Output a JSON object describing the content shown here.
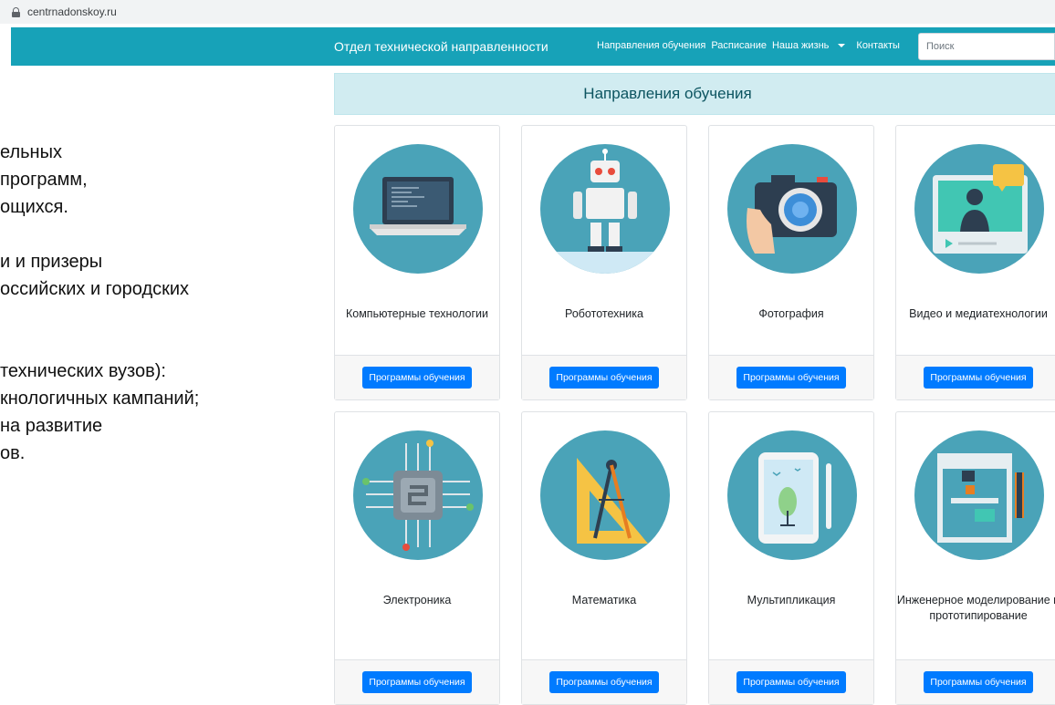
{
  "browser": {
    "url": "centrnadonskoy.ru"
  },
  "navbar": {
    "brand": "Отдел технической направленности",
    "links": [
      "Направления обучения",
      "Расписание",
      "Наша жизнь",
      "Контакты"
    ],
    "search_placeholder": "Поиск",
    "bg_color": "#17a2b8"
  },
  "left_text": [
    "ельных",
    " программ,",
    "ощихся.",
    "",
    "и и призеры",
    "оссийских и городских",
    "",
    "",
    "технических вузов):",
    "кнологичных кампаний;",
    "на развитие",
    "ов."
  ],
  "section": {
    "title": "Направления обучения"
  },
  "cards": [
    {
      "title": "Компьютерные технологии",
      "icon": "laptop-icon",
      "button": "Программы обучения"
    },
    {
      "title": "Робототехника",
      "icon": "robot-icon",
      "button": "Программы обучения"
    },
    {
      "title": "Фотография",
      "icon": "camera-icon",
      "button": "Программы обучения"
    },
    {
      "title": "Видео и медиатехнологии",
      "icon": "video-icon",
      "button": "Программы обучения"
    },
    {
      "title": "Электроника",
      "icon": "chip-icon",
      "button": "Программы обучения"
    },
    {
      "title": "Математика",
      "icon": "compass-ruler-icon",
      "button": "Программы обучения"
    },
    {
      "title": "Мультипликация",
      "icon": "tablet-drawing-icon",
      "button": "Программы обучения"
    },
    {
      "title": "Инженерное моделирование и прототипирование",
      "icon": "3d-printer-icon",
      "button": "Программы обучения"
    }
  ]
}
